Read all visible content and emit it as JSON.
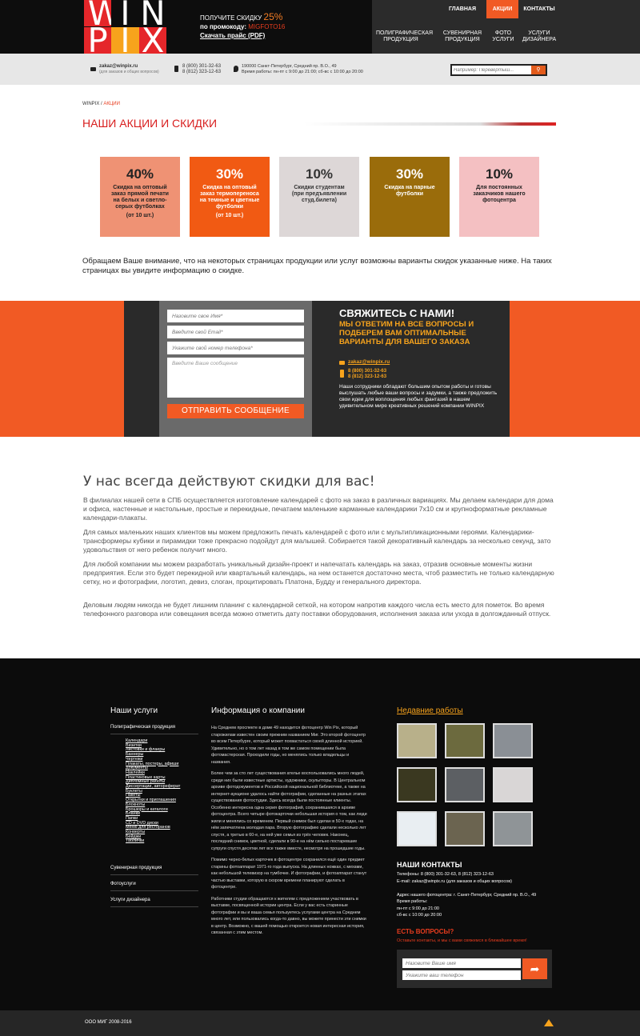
{
  "colors": {
    "accent": "#f15a24",
    "red": "#d81e1e",
    "orange": "#f7a31c",
    "dark": "#0d0d0d"
  },
  "logo": {
    "letters": [
      "W",
      "I",
      "N",
      "P",
      "I",
      "X"
    ]
  },
  "promo": {
    "line1": "ПОЛУЧИТЕ СКИДКУ",
    "pct": "25%",
    "line2": "по промокоду:",
    "code": "MIGFOTO16",
    "price_link": "Скачать прайс (PDF)"
  },
  "topnav": {
    "items": [
      "ГЛАВНАЯ",
      "АКЦИИ",
      "КОНТАКТЫ"
    ],
    "active": "АКЦИИ"
  },
  "subnav": [
    [
      "ПОЛИГРАФИЧЕСКАЯ",
      "ПРОДУКЦИЯ"
    ],
    [
      "СУВЕНИРНАЯ",
      "ПРОДУКЦИЯ"
    ],
    [
      "ФОТО",
      "УСЛУГИ"
    ],
    [
      "УСЛУГИ",
      "ДИЗАЙНЕРА"
    ]
  ],
  "contactbar": {
    "email": "zakaz@winpix.ru",
    "email_note": "(для заказов и общих вопросов)",
    "phone1": "8 (800) 301-32-63",
    "phone2": "8 (812) 323-12-63",
    "address": "190000 Санкт-Петербург, Средний пр. В.О., 49",
    "hours": "Время работы: пн-пт с 9:00 до 21:00; сб-вс  с 10:00 до 20:00",
    "search_placeholder": "Например: Перевертыш..."
  },
  "breadcrumb": {
    "home": "WINPIX",
    "sep": "/",
    "current": "АКЦИИ"
  },
  "page_title": "НАШИ АКЦИИ И СКИДКИ",
  "tiles": [
    {
      "pct": "40%",
      "text": "Скидка на оптовый заказ прямой печати на белых и светло-серых футболках",
      "extra": "(от 10 шт.)",
      "bg": "#ef9274",
      "color": "#222"
    },
    {
      "pct": "30%",
      "text": "Скидка на оптовый заказ термопереноса на темные и цветные футболки",
      "extra": "(от 10 шт.)",
      "bg": "#f15a13",
      "color": "#fff"
    },
    {
      "pct": "10%",
      "text": "Скидки студентам (при предъявлении студ.билета)",
      "extra": "",
      "bg": "#ddd7d7",
      "color": "#333"
    },
    {
      "pct": "30%",
      "text": "Скидка на парные футболки",
      "extra": "",
      "bg": "#9a6c0b",
      "color": "#fff"
    },
    {
      "pct": "10%",
      "text": "Для постоянных заказчиков нашего фотоцентра",
      "extra": "",
      "bg": "#f4c0c2",
      "color": "#222"
    }
  ],
  "notice": "Обращаем Ваше внимание, что на некоторых страницах продукции или услуг возможны варианты скидок указанные ниже. На таких страницах вы увидите информацию о скидке.",
  "form": {
    "name_ph": "Назовите свое Имя*",
    "email_ph": "Введите свой Email*",
    "phone_ph": "Укажите свой номер телефона*",
    "msg_ph": "Введите Ваше сообщение",
    "send": "ОТПРАВИТЬ СООБЩЕНИЕ",
    "head": "СВЯЖИТЕСЬ С НАМИ!",
    "sub": "МЫ ОТВЕТИМ НА ВСЕ ВОПРОСЫ И ПОДБЕРЕМ ВАМ ОПТИМАЛЬНЫЕ ВАРИАНТЫ ДЛЯ ВАШЕГО ЗАКАЗА",
    "email": "zakaz@winpix.ru",
    "phone1": "8 (800) 301-32-63",
    "phone2": "8 (812) 323-12-63",
    "text": "Наши сотрудники обладают большим опытом работы и готовы выслушать любые ваши вопросы и задумки, а также предложить свои идеи для воплощения любых фантазий в нашем удивительном мире креативных решений компании WINPIX"
  },
  "article": {
    "heading": "У нас всегда действуют скидки для вас!",
    "p1": "В филиалах нашей сети в СПБ осуществляется изготовление календарей с фото на заказ в различных вариациях. Мы делаем календари для дома и офиса, настенные и настольные, простые и перекидные, печатаем маленькие карманные календарики 7х10 см и крупноформатные рекламные календари-плакаты.",
    "p2": "Для самых маленьких наших клиентов мы можем предложить печать календарей с фото или с мультипликационными героями. Календарики-трансформеры  кубики и пирамидки  тоже прекрасно подойдут для малышей. Собирается такой декоративный календарь за несколько секунд, зато удовольствия от него ребенок получит много.",
    "p3": "Для любой компании мы можем разработать уникальный дизайн-проект и напечатать календарь на заказ, отразив основные моменты жизни предприятия. Если  это будет перекидной или квартальный календарь, на нем останется достаточно места, чтоб разместить не только календарную сетку, но и фотографии, логотип, девиз, слоган, процитировать Платона, Будду и генерального директора.",
    "p4": "Деловым людям никогда не будет лишним планинг с календарной сеткой, на котором напротив каждого числа есть место для пометок. Во время телефонного разговора или совещания всегда можно отметить дату поставки оборудования, исполнения заказа или ухода в долгожданный отпуск."
  },
  "footer": {
    "services_head": "Наши услуги",
    "svc_main": "Полиграфическая продукция",
    "svc_sub": [
      "Календари",
      "Визитки",
      "Листовки и флаеры",
      "Баннеры",
      "Чертежи",
      "Плакаты, постеры, афиши",
      "Документы",
      "Наклейки",
      "Пластиковые карты",
      "Дипломные работы",
      "Диссертации, автореферат",
      "Буклеты",
      "Пакеты",
      "Открытки и приглашения",
      "Блокноты",
      "Брошюры и каталоги",
      "Бланки",
      "Папки",
      "CD и DVD диски",
      "Меню для ресторанов",
      "Конверты",
      "Бейджи",
      "Таблички"
    ],
    "svc_other": [
      "Сувенирная продукция",
      "Фотоуслуги",
      "Услуги дизайнера"
    ],
    "info_head": "Информация о компании",
    "info": [
      "На Среднем проспекте в доме 49 находится фотоцентр Win Pix, который старожилам известен своим прежним названием Миг. Это второй фотоцентр во всем Петербурге, который может похвастаться своей длинной историей. Удивительно, но о том лет назад в том же самом помещении была фотомастерская. Проходили годы, но менялись только владельцы и названия.",
      "Более чем за сто лет существования ателье воспользовались много людей, среди них были известные артисты, художники, скульпторы. В Центральном архиве фотодокументов и Российской национальной библиотеке, а также на интернет-аукционе удалось найти фотографии, сделанные на разных этапах существования фотостудии. Здесь всегда были постоянные клиенты. Особенно интересна одна серия фотографий, сохранившаяся в архиве фотоцентра. Всего четыре фотокарточки  небольшая история о том, как люди жили и менялись со временем. Первый снимок был сделан в 50-х годах, на нём запечатлена молодая пара. Вторую фотографию сделали несколько лет спустя, а третью в 60-е, на ней уже семья из трёх человек. Наконец, последний снимок, цветной, сделали в 90-е  на нём сильно постаревшие супруги спустя десятки лет все также вместе, несмотря на прошедшие годы.",
      "Помимо черно-белых карточек в фотоцентре сохранился ещё один предмет старины  фотоаппарат 1971-го года выпуска. На длинных ножках, с мехами, как небольшой телевизор на тумбочке. И фотографии, и фотоаппарат станут частью выставки, которую в скором времени планируют сделать в фотоцентре.",
      "Работники студии обращаются к жителям с предложением участвовать в выставке, посвященной истории центра. Если у вас есть старинные фотографии и вы и ваша семья пользуетесь услугами центра на Среднем много лет, или пользовались когда-то давно, вы можете принести эти снимки в центр. Возможно, с вашей помощью откроется новая интересная история, связанная с этим местом."
    ],
    "recent_head": "Недавние работы",
    "thumbs": [
      "#b8b08a",
      "#6c6a3e",
      "#8a8f95",
      "#3a3820",
      "#5c5f63",
      "#d9d6d6",
      "#e9eef2",
      "#6b6450",
      "#8f9497"
    ],
    "contacts_head": "НАШИ КОНТАКТЫ",
    "contacts": [
      "Телефоны: 8 (800) 301-32-63, 8 (812) 323-12-63",
      "E-mail: zakaz@winpix.ru (для заказов и общих вопросов)",
      "",
      "Адрес нашего фотоцентра: г. Санкт-Петербург, Средний пр. В.О., 49",
      "Время работы:",
      "пн-пт с 9:00 до 21:00",
      "сб-вс с 10:00 до 20:00"
    ],
    "q_head": "ЕСТЬ ВОПРОСЫ?",
    "q_sub": "Оставьте контакты, и мы с вами свяжемся в ближайшее время!",
    "q_name": "Назовите Ваше имя",
    "q_phone": "Укажите ваш телефон",
    "q_btn": "➦"
  },
  "copyright": "ООО МИГ 2008-2016"
}
